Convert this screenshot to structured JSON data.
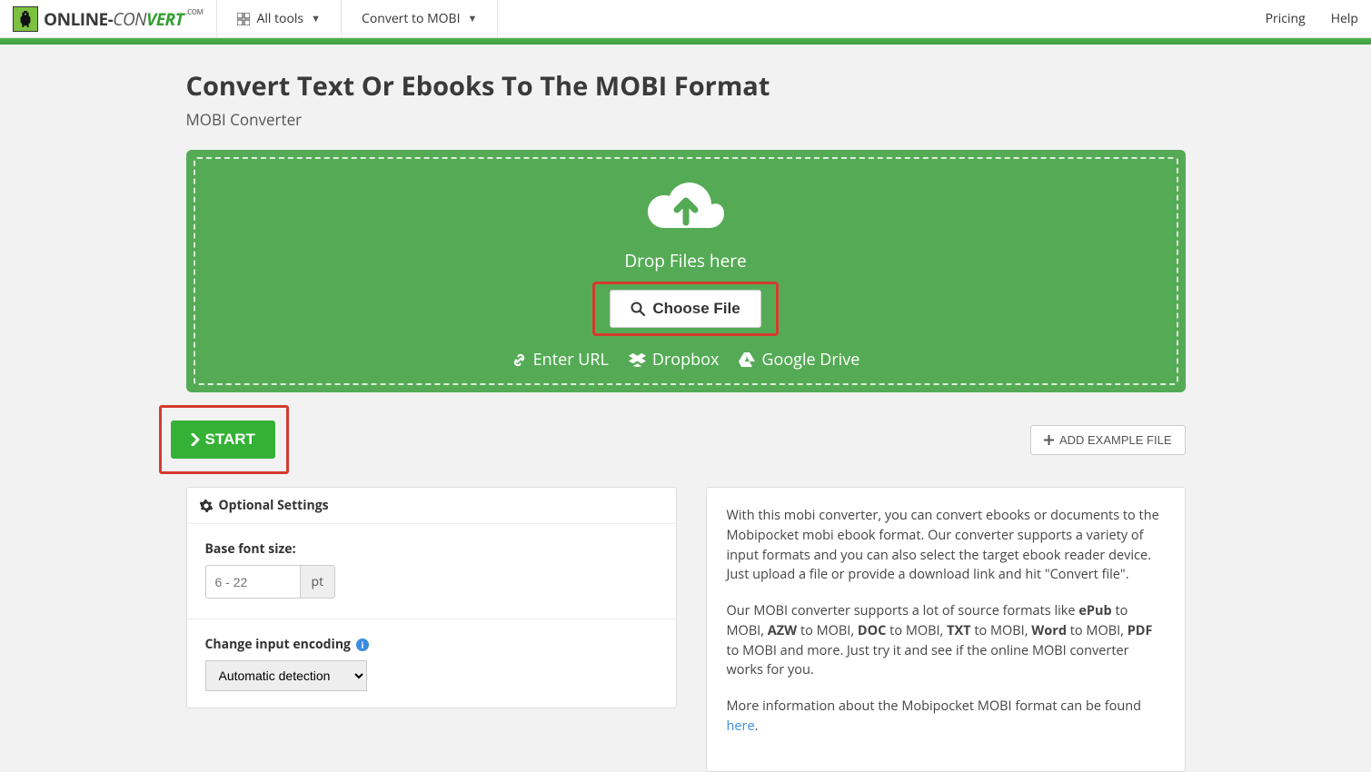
{
  "header": {
    "logo_part1": "ONLINE-",
    "logo_part2": "CON",
    "logo_part3": "VERT",
    "logo_suffix": ".COM",
    "all_tools": "All tools",
    "convert_to": "Convert to MOBI",
    "pricing": "Pricing",
    "help": "Help"
  },
  "page": {
    "title": "Convert Text Or Ebooks To The MOBI Format",
    "subtitle": "MOBI Converter"
  },
  "dropzone": {
    "drop_text": "Drop Files here",
    "choose_file": "Choose File",
    "enter_url": "Enter URL",
    "dropbox": "Dropbox",
    "google_drive": "Google Drive"
  },
  "actions": {
    "start": "START",
    "add_example": "ADD EXAMPLE FILE"
  },
  "settings": {
    "header": "Optional Settings",
    "base_font_label": "Base font size:",
    "base_font_placeholder": "6 - 22",
    "base_font_unit": "pt",
    "encoding_label": "Change input encoding",
    "encoding_value": "Automatic detection"
  },
  "info": {
    "para1": "With this mobi converter, you can convert ebooks or documents to the Mobipocket mobi ebook format. Our converter supports a variety of input formats and you can also select the target ebook reader device. Just upload a file or provide a download link and hit \"Convert file\".",
    "para2_a": "Our MOBI converter supports a lot of source formats like ",
    "para2_b": " to MOBI, ",
    "para2_c": " to MOBI and more. Just try it and see if the online MOBI converter works for you.",
    "fmt_epub": "ePub",
    "fmt_azw": "AZW",
    "fmt_doc": "DOC",
    "fmt_txt": "TXT",
    "fmt_word": "Word",
    "fmt_pdf": "PDF",
    "para3_a": "More information about the Mobipocket MOBI format can be found ",
    "para3_link": "here",
    "para3_b": "."
  }
}
